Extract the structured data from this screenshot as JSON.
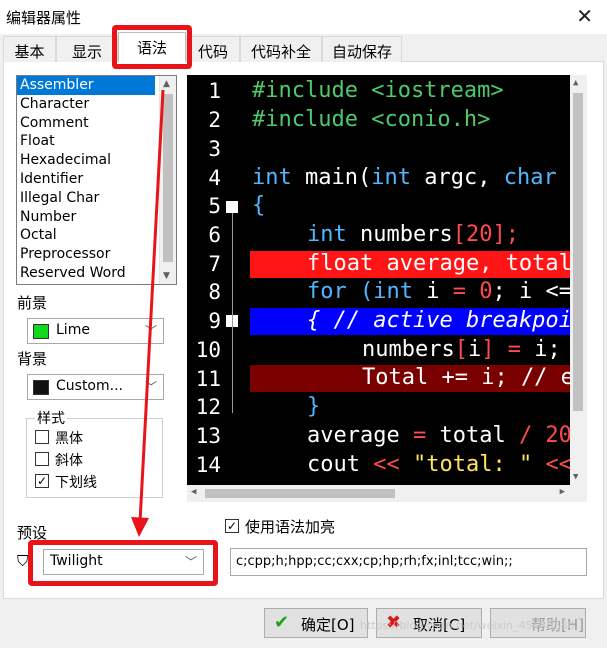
{
  "window": {
    "title": "编辑器属性",
    "close": "✕"
  },
  "tabs": [
    {
      "label": "基本"
    },
    {
      "label": "显示"
    },
    {
      "label": "语法"
    },
    {
      "label": "代码"
    },
    {
      "label": "代码补全"
    },
    {
      "label": "自动保存"
    }
  ],
  "element_list": [
    "Assembler",
    "Character",
    "Comment",
    "Float",
    "Hexadecimal",
    "Identifier",
    "Illegal Char",
    "Number",
    "Octal",
    "Preprocessor",
    "Reserved Word"
  ],
  "foreground": {
    "label": "前景",
    "value": "Lime",
    "swatch": "#10d81a"
  },
  "background": {
    "label": "背景",
    "value": "Custom...",
    "swatch": "#111111"
  },
  "style": {
    "title": "样式",
    "options": [
      {
        "label": "黑体",
        "checked": ""
      },
      {
        "label": "斜体",
        "checked": ""
      },
      {
        "label": "下划线",
        "checked": "✓"
      }
    ]
  },
  "preview": {
    "line_numbers": [
      "1",
      "2",
      "3",
      "4",
      "5",
      "6",
      "7",
      "8",
      "9",
      "10",
      "11",
      "12",
      "13",
      "14"
    ],
    "lines": {
      "l1": "#include <iostream>",
      "l2": "#include <conio.h>",
      "l4a": "int",
      "l4b": " main(",
      "l4c": "int",
      "l4d": " argc, ",
      "l4e": "char",
      "l5": "{",
      "l6a": "int",
      "l6b": " numbers",
      "l6c": "[",
      "l6d": "20",
      "l6e": "];",
      "l7": "float average, total",
      "l8a": "for",
      "l8b": " (",
      "l8c": "int",
      "l8d": " i ",
      "l8e": "=",
      "l8f": " ",
      "l8g": "0",
      "l8h": "; i <=",
      "l9": "{ // active breakpoi",
      "l10a": "numbers",
      "l10b": "[",
      "l10c": "i",
      "l10d": "] ",
      "l10e": "=",
      "l10f": " i;",
      "l11": "Total += i; // e",
      "l12": "}",
      "l13a": "average ",
      "l13b": "=",
      "l13c": " total ",
      "l13d": "/",
      "l13e": " 20",
      "l14a": "cout ",
      "l14b": "<<",
      "l14c": " \"total: \" ",
      "l14d": "<<"
    },
    "colors": {
      "error_line": "#ff1515",
      "breakpoint_line": "#0000ff",
      "exec_line": "#7a0000"
    }
  },
  "enable_syntax": {
    "label": "使用语法加亮",
    "checked": "✓"
  },
  "preset": {
    "label": "预设",
    "value": "Twilight"
  },
  "extensions": "c;cpp;h;hpp;cc;cxx;cp;hp;rh;fx;inl;tcc;win;;",
  "buttons": {
    "ok": "确定[O]",
    "cancel": "取消[C]",
    "help": "帮助[H]"
  },
  "watermark": "https://blog.csdn.net/weixin_45485380"
}
